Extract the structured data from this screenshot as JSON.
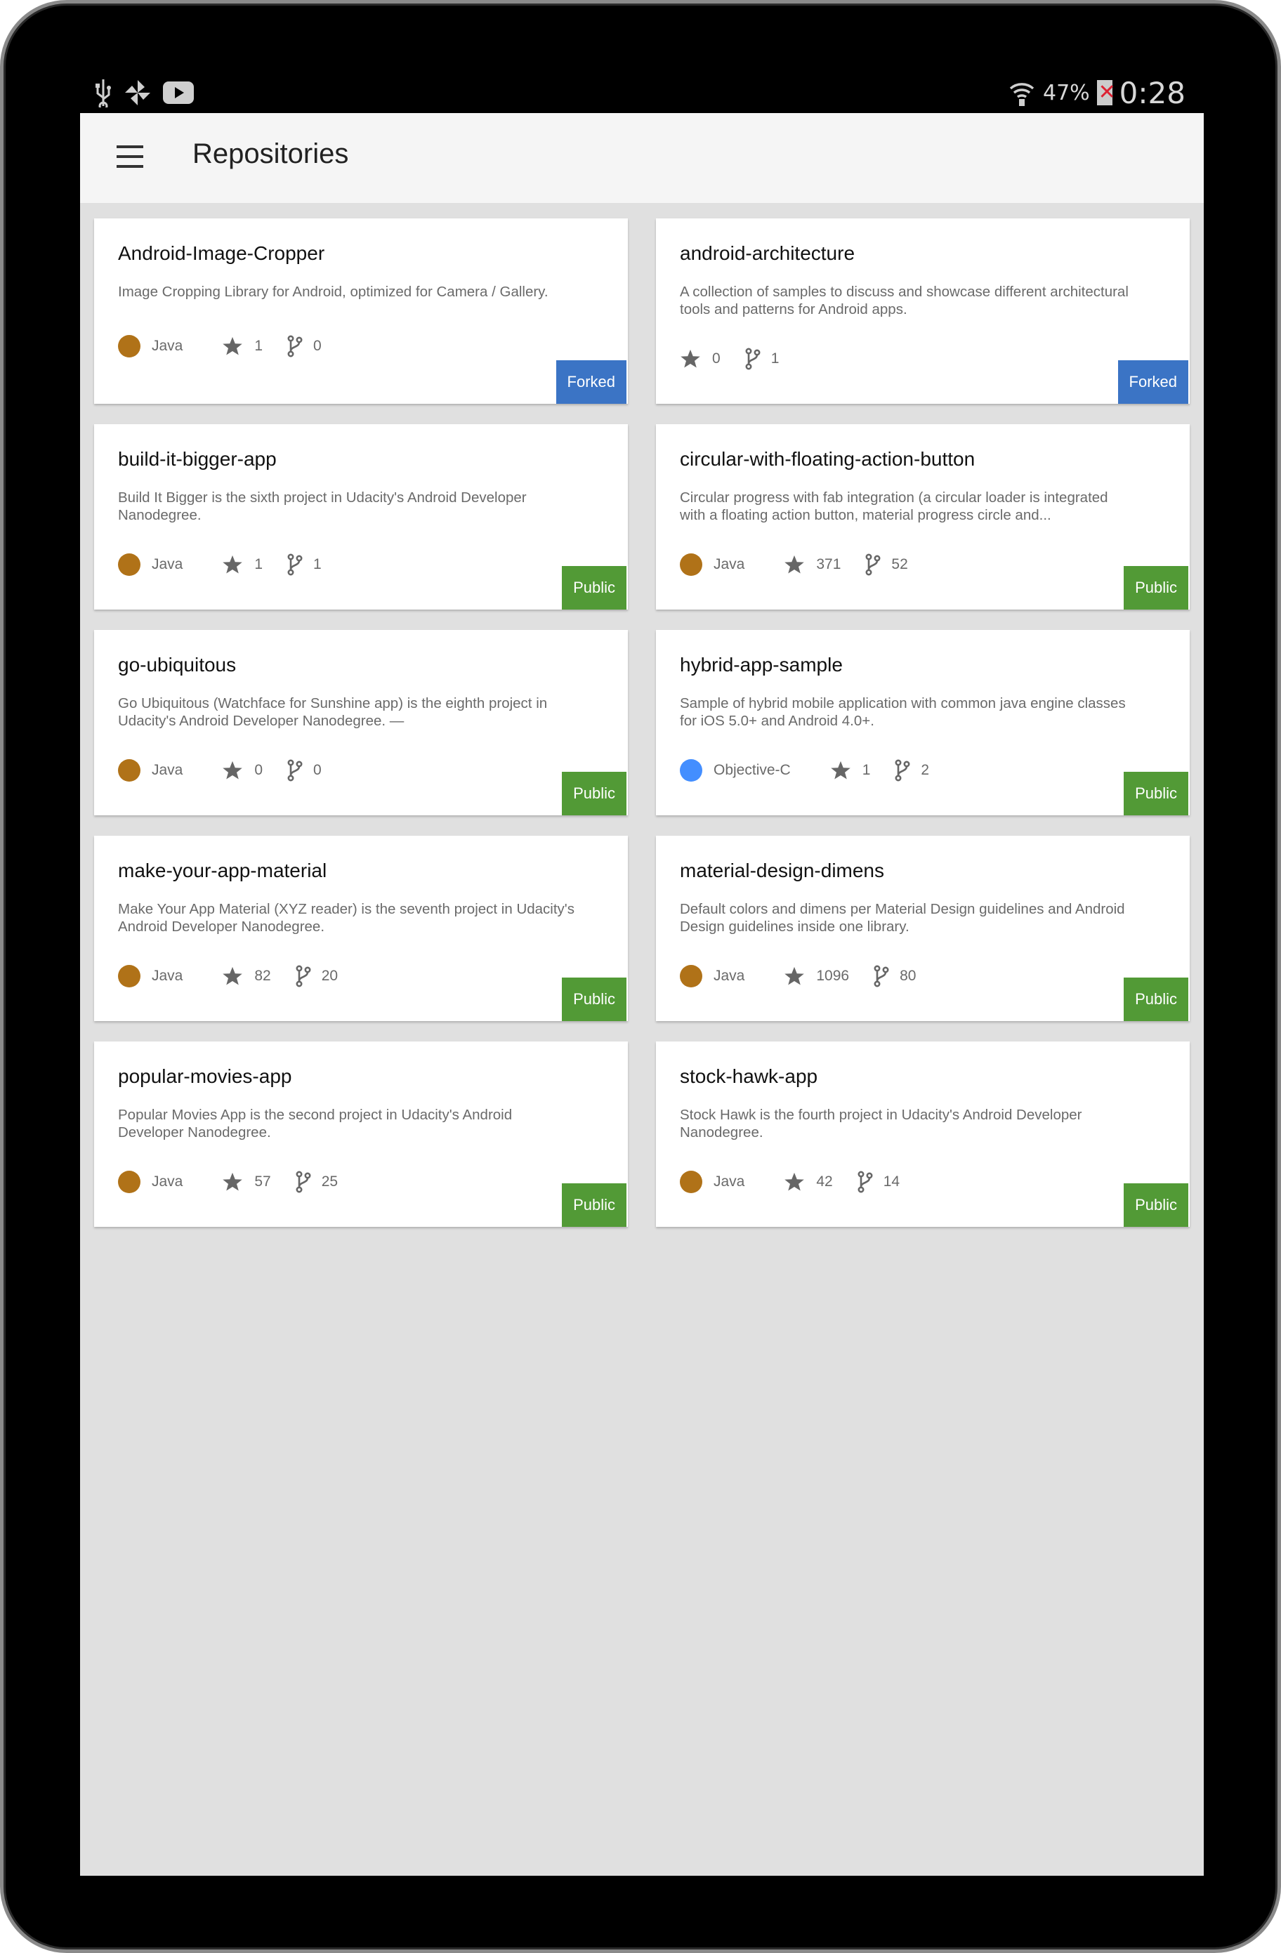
{
  "status_bar": {
    "battery_percent": "47%",
    "time": "0:28"
  },
  "app_bar": {
    "title": "Repositories"
  },
  "colors": {
    "java": "#b07218",
    "objective_c": "#438eff",
    "forked_badge": "#3b74c5",
    "public_badge": "#529a36"
  },
  "left_column": [
    {
      "name": "Android-Image-Cropper",
      "description_lines": [
        "Image Cropping Library for Android, optimized for Camera / Gallery."
      ],
      "language": "Java",
      "stars": "1",
      "forks": "0",
      "badge": "Forked"
    },
    {
      "name": "build-it-bigger-app",
      "description_lines": [
        "Build It Bigger is the sixth project in Udacity's Android Developer",
        "Nanodegree."
      ],
      "language": "Java",
      "stars": "1",
      "forks": "1",
      "badge": "Public"
    },
    {
      "name": "go-ubiquitous",
      "description_lines": [
        "Go Ubiquitous (Watchface for Sunshine app) is the eighth project in",
        "Udacity's Android Developer Nanodegree. —"
      ],
      "language": "Java",
      "stars": "0",
      "forks": "0",
      "badge": "Public"
    },
    {
      "name": "make-your-app-material",
      "description_lines": [
        "Make Your App Material (XYZ reader) is the seventh project in Udacity's",
        "Android Developer Nanodegree."
      ],
      "language": "Java",
      "stars": "82",
      "forks": "20",
      "badge": "Public"
    },
    {
      "name": "popular-movies-app",
      "description_lines": [
        "Popular Movies App is the second project in Udacity's Android",
        "Developer Nanodegree."
      ],
      "language": "Java",
      "stars": "57",
      "forks": "25",
      "badge": "Public"
    }
  ],
  "right_column": [
    {
      "name": "android-architecture",
      "description_lines": [
        "A collection of samples to discuss and showcase different architectural",
        "tools and patterns for Android apps."
      ],
      "language": "",
      "stars": "0",
      "forks": "1",
      "badge": "Forked"
    },
    {
      "name": "circular-with-floating-action-button",
      "description_lines": [
        "Circular progress with fab integration (a circular loader is integrated",
        "with a floating action button, material progress circle and..."
      ],
      "language": "Java",
      "stars": "371",
      "forks": "52",
      "badge": "Public"
    },
    {
      "name": "hybrid-app-sample",
      "description_lines": [
        "Sample of hybrid mobile application with common java engine classes",
        "for iOS 5.0+ and Android 4.0+."
      ],
      "language": "Objective-C",
      "stars": "1",
      "forks": "2",
      "badge": "Public"
    },
    {
      "name": "material-design-dimens",
      "description_lines": [
        "Default colors and dimens per Material Design guidelines and Android",
        "Design guidelines inside one library."
      ],
      "language": "Java",
      "stars": "1096",
      "forks": "80",
      "badge": "Public"
    },
    {
      "name": "stock-hawk-app",
      "description_lines": [
        "Stock Hawk is the fourth project in Udacity's Android Developer",
        "Nanodegree."
      ],
      "language": "Java",
      "stars": "42",
      "forks": "14",
      "badge": "Public"
    }
  ]
}
